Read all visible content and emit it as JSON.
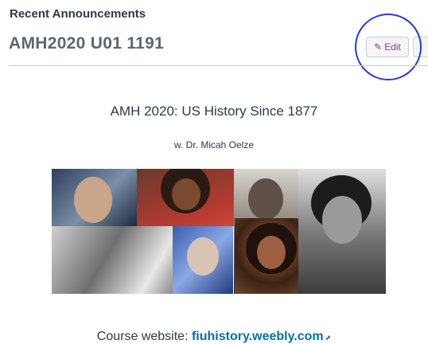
{
  "widget": {
    "heading": "Recent Announcements"
  },
  "course": {
    "code": "AMH2020 U01 1191"
  },
  "toolbar": {
    "edit_label": "Edit",
    "edit_icon": "pencil-icon"
  },
  "content": {
    "title": "AMH 2020: US History Since 1877",
    "author": "w. Dr. Micah Oelze",
    "website_prefix": "Course website:",
    "website_link": "fiuhistory.weebly.com"
  },
  "colors": {
    "accent_circle": "#2a3ad6",
    "link": "#0770a3",
    "edit_text": "#8a3d8a"
  }
}
